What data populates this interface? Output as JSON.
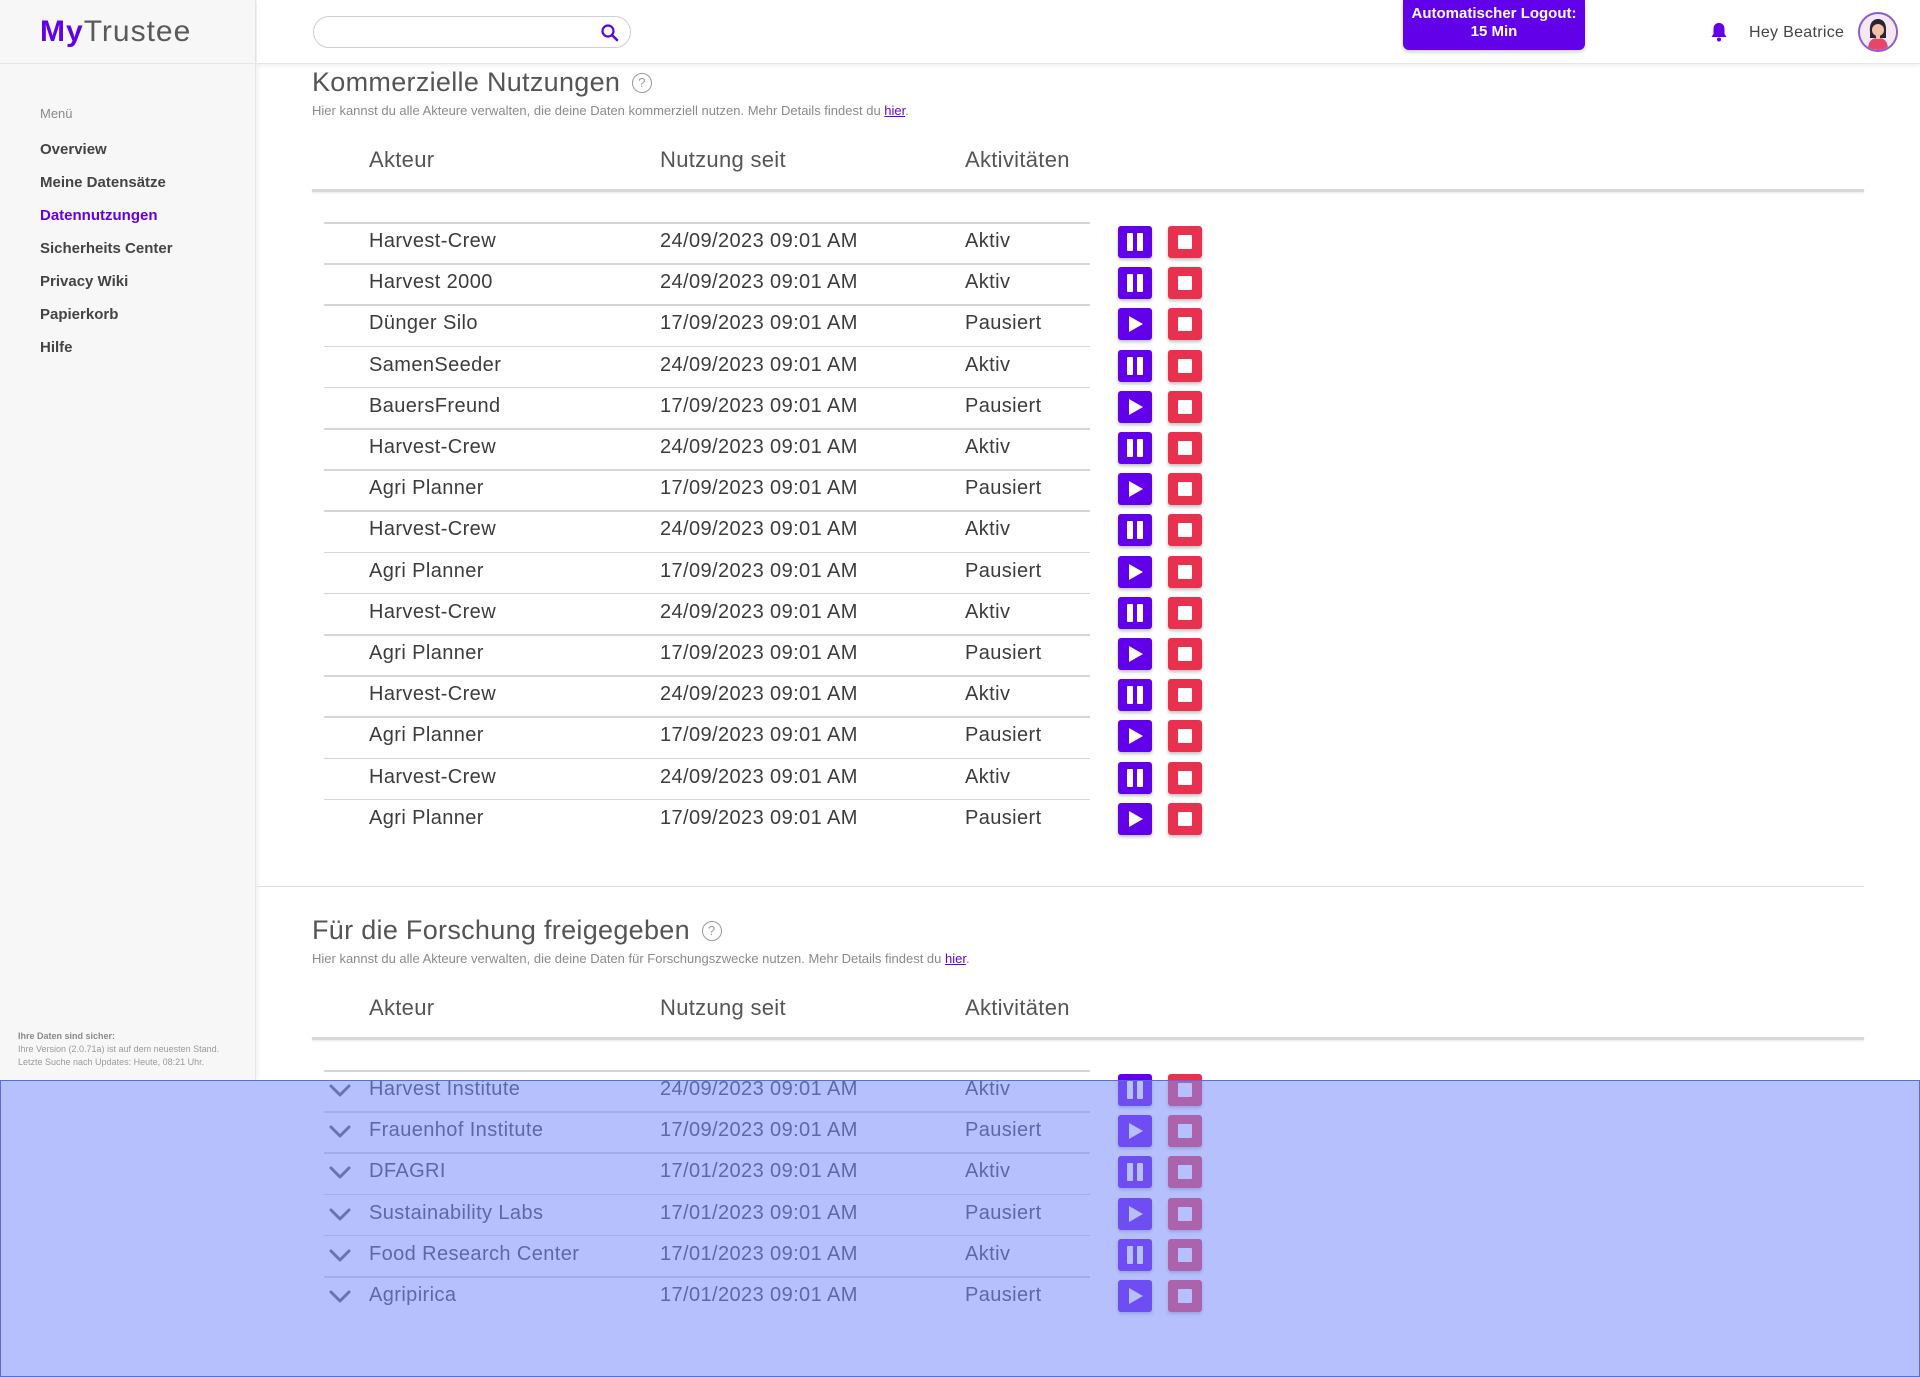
{
  "app": {
    "logo_my": "My",
    "logo_trustee": "Trustee"
  },
  "sidebar": {
    "menu_label": "Menü",
    "items": [
      {
        "label": "Overview",
        "active": false
      },
      {
        "label": "Meine Datensätze",
        "active": false
      },
      {
        "label": "Datennutzungen",
        "active": true
      },
      {
        "label": "Sicherheits Center",
        "active": false
      },
      {
        "label": "Privacy Wiki",
        "active": false
      },
      {
        "label": "Papierkorb",
        "active": false
      },
      {
        "label": "Hilfe",
        "active": false
      }
    ],
    "footer": {
      "title": "Ihre Daten sind sicher:",
      "line1": "Ihre Version (2.0.71a) ist auf dem neuesten Stand.",
      "line2": "Letzte Suche nach Updates: Heute, 08:21 Uhr."
    }
  },
  "header": {
    "search_value": "",
    "search_icon": "search-icon",
    "logout_line1": "Automatischer Logout:",
    "logout_line2": "15 Min",
    "bell_icon": "bell-icon",
    "greeting": "Hey Beatrice"
  },
  "colors": {
    "accent": "#6200ea",
    "stop": "#e8314f",
    "overlay": "#788cfa"
  },
  "commercial": {
    "title": "Kommerzielle Nutzungen",
    "subtitle": "Hier kannst du alle Akteure verwalten, die deine Daten kommerziell nutzen. Mehr Details findest du ",
    "link": "hier",
    "subtitle_end": ".",
    "columns": [
      "Akteur",
      "Nutzung seit",
      "Aktivitäten"
    ],
    "rows": [
      {
        "actor": "Harvest-Crew",
        "since": "24/09/2023 09:01 AM",
        "status": "Aktiv"
      },
      {
        "actor": "Harvest 2000",
        "since": "24/09/2023 09:01 AM",
        "status": "Aktiv"
      },
      {
        "actor": "Dünger Silo",
        "since": "17/09/2023 09:01 AM",
        "status": "Pausiert"
      },
      {
        "actor": "SamenSeeder",
        "since": "24/09/2023 09:01 AM",
        "status": "Aktiv"
      },
      {
        "actor": "BauersFreund",
        "since": "17/09/2023 09:01 AM",
        "status": "Pausiert"
      },
      {
        "actor": "Harvest-Crew",
        "since": "24/09/2023 09:01 AM",
        "status": "Aktiv"
      },
      {
        "actor": "Agri Planner",
        "since": "17/09/2023 09:01 AM",
        "status": "Pausiert"
      },
      {
        "actor": "Harvest-Crew",
        "since": "24/09/2023 09:01 AM",
        "status": "Aktiv"
      },
      {
        "actor": "Agri Planner",
        "since": "17/09/2023 09:01 AM",
        "status": "Pausiert"
      },
      {
        "actor": "Harvest-Crew",
        "since": "24/09/2023 09:01 AM",
        "status": "Aktiv"
      },
      {
        "actor": "Agri Planner",
        "since": "17/09/2023 09:01 AM",
        "status": "Pausiert"
      },
      {
        "actor": "Harvest-Crew",
        "since": "24/09/2023 09:01 AM",
        "status": "Aktiv"
      },
      {
        "actor": "Agri Planner",
        "since": "17/09/2023 09:01 AM",
        "status": "Pausiert"
      },
      {
        "actor": "Harvest-Crew",
        "since": "24/09/2023 09:01 AM",
        "status": "Aktiv"
      },
      {
        "actor": "Agri Planner",
        "since": "17/09/2023 09:01 AM",
        "status": "Pausiert"
      }
    ]
  },
  "research": {
    "title": "Für die Forschung freigegeben",
    "subtitle": "Hier kannst du alle Akteure verwalten, die deine Daten für Forschungszwecke nutzen. Mehr Details findest du ",
    "link": "hier",
    "subtitle_end": ".",
    "columns": [
      "Akteur",
      "Nutzung seit",
      "Aktivitäten"
    ],
    "rows": [
      {
        "actor": "Harvest Institute",
        "since": "24/09/2023 09:01 AM",
        "status": "Aktiv"
      },
      {
        "actor": "Frauenhof Institute",
        "since": "17/09/2023 09:01 AM",
        "status": "Pausiert"
      },
      {
        "actor": "DFAGRI",
        "since": "17/01/2023 09:01 AM",
        "status": "Aktiv"
      },
      {
        "actor": "Sustainability Labs",
        "since": "17/01/2023 09:01 AM",
        "status": "Pausiert"
      },
      {
        "actor": "Food Research Center",
        "since": "17/01/2023 09:01 AM",
        "status": "Aktiv"
      },
      {
        "actor": "Agripirica",
        "since": "17/01/2023 09:01 AM",
        "status": "Pausiert"
      }
    ]
  }
}
